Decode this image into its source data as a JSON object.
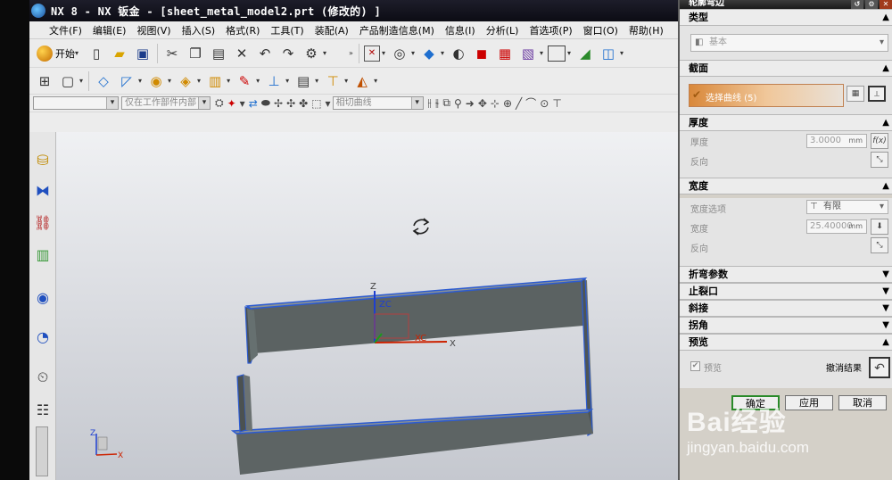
{
  "window": {
    "title": "NX 8 - NX 钣金 - [sheet_metal_model2.prt  (修改的) ]"
  },
  "menu": [
    "文件(F)",
    "编辑(E)",
    "视图(V)",
    "插入(S)",
    "格式(R)",
    "工具(T)",
    "装配(A)",
    "产品制造信息(M)",
    "信息(I)",
    "分析(L)",
    "首选项(P)",
    "窗口(O)",
    "帮助(H)"
  ],
  "toolbar": {
    "start_label": "开始",
    "filter_combo_1": "",
    "filter_combo_2": "仅在工作部件内部",
    "filter_combo_3": "相切曲线"
  },
  "canvas": {
    "csys_z": "Z",
    "csys_zc": "ZC",
    "csys_xc": "XC",
    "csys_x": "X",
    "triad_z": "Z",
    "triad_x": "X"
  },
  "dialog": {
    "title": "轮廓弯边",
    "sections": {
      "type": {
        "title": "类型",
        "value": "基本"
      },
      "section": {
        "title": "截面",
        "select_label": "选择曲线 (5)"
      },
      "thickness": {
        "title": "厚度",
        "thickness_label": "厚度",
        "thickness_value": "3.0000",
        "thickness_unit": "mm",
        "reverse_label": "反向"
      },
      "width": {
        "title": "宽度",
        "option_label": "宽度选项",
        "option_value": "有限",
        "width_label": "宽度",
        "width_value": "25.40000",
        "width_unit": "mm",
        "reverse_label": "反向"
      },
      "bend_params": {
        "title": "折弯参数"
      },
      "relief": {
        "title": "止裂口"
      },
      "miter": {
        "title": "斜接"
      },
      "corner": {
        "title": "拐角"
      },
      "preview": {
        "title": "预览",
        "checkbox_label": "预览",
        "undo_label": "撤消结果"
      }
    },
    "buttons": {
      "ok": "确定",
      "apply": "应用",
      "cancel": "取消"
    }
  },
  "watermark": {
    "brand": "Bai经验",
    "url": "jingyan.baidu.com"
  },
  "colors": {
    "title_bar": "#0c0c14",
    "select_highlight": "#e6a058",
    "sheet_metal": "#5d6464",
    "selected_edge": "#2c5bd1"
  }
}
